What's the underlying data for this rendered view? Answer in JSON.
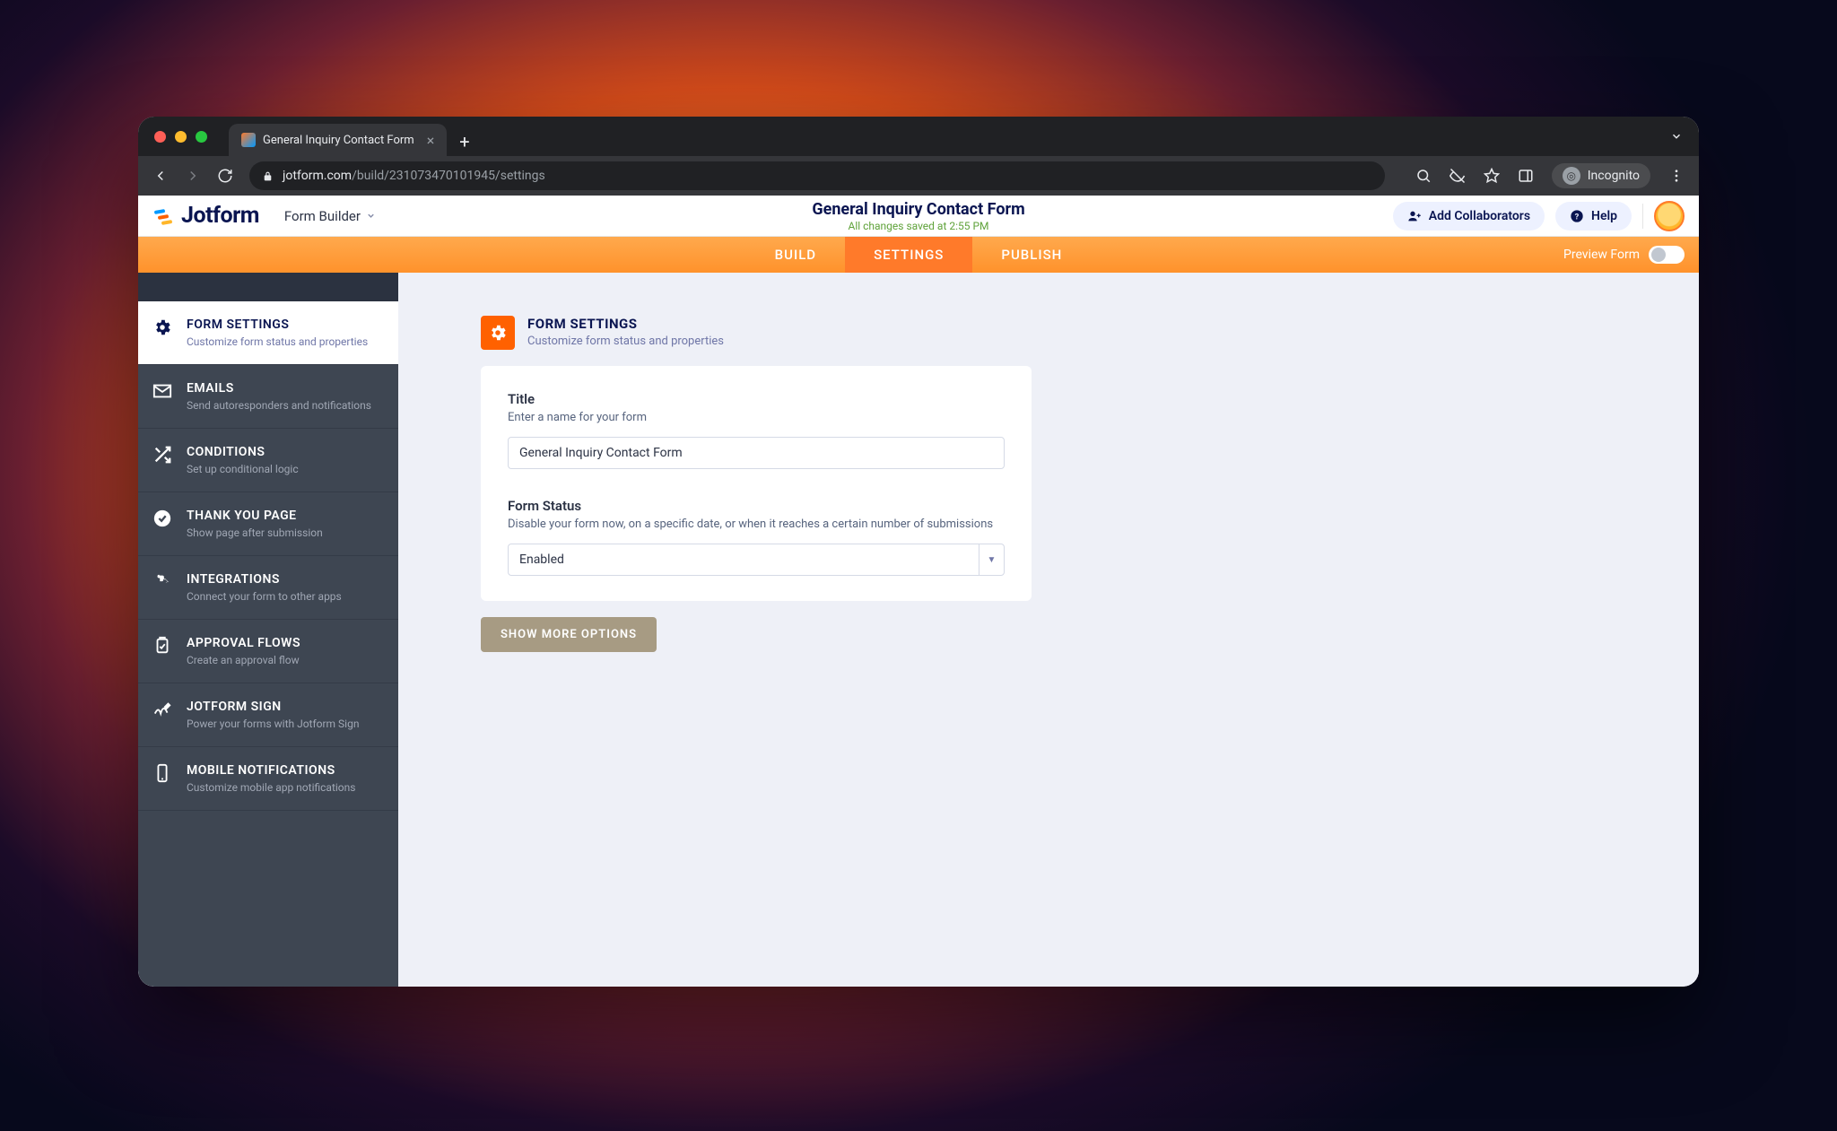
{
  "browser": {
    "tab_title": "General Inquiry Contact Form",
    "url_host": "jotform.com",
    "url_path": "/build/231073470101945/settings",
    "incognito_label": "Incognito"
  },
  "header": {
    "logo_text": "Jotform",
    "form_builder_label": "Form Builder",
    "title": "General Inquiry Contact Form",
    "saved": "All changes saved at 2:55 PM",
    "add_collaborators": "Add Collaborators",
    "help": "Help"
  },
  "tabs": {
    "build": "BUILD",
    "settings": "SETTINGS",
    "publish": "PUBLISH",
    "preview": "Preview Form"
  },
  "sidebar": {
    "form_settings": {
      "title": "FORM SETTINGS",
      "sub": "Customize form status and properties"
    },
    "emails": {
      "title": "EMAILS",
      "sub": "Send autoresponders and notifications"
    },
    "conditions": {
      "title": "CONDITIONS",
      "sub": "Set up conditional logic"
    },
    "thank_you": {
      "title": "THANK YOU PAGE",
      "sub": "Show page after submission"
    },
    "integrations": {
      "title": "INTEGRATIONS",
      "sub": "Connect your form to other apps"
    },
    "approval_flows": {
      "title": "APPROVAL FLOWS",
      "sub": "Create an approval flow"
    },
    "jotform_sign": {
      "title": "JOTFORM SIGN",
      "sub": "Power your forms with Jotform Sign"
    },
    "mobile_notifications": {
      "title": "MOBILE NOTIFICATIONS",
      "sub": "Customize mobile app notifications"
    }
  },
  "panel": {
    "title": "FORM SETTINGS",
    "sub": "Customize form status and properties",
    "title_field_label": "Title",
    "title_field_help": "Enter a name for your form",
    "title_field_value": "General Inquiry Contact Form",
    "status_label": "Form Status",
    "status_help": "Disable your form now, on a specific date, or when it reaches a certain number of submissions",
    "status_value": "Enabled",
    "more_btn": "SHOW MORE OPTIONS"
  }
}
